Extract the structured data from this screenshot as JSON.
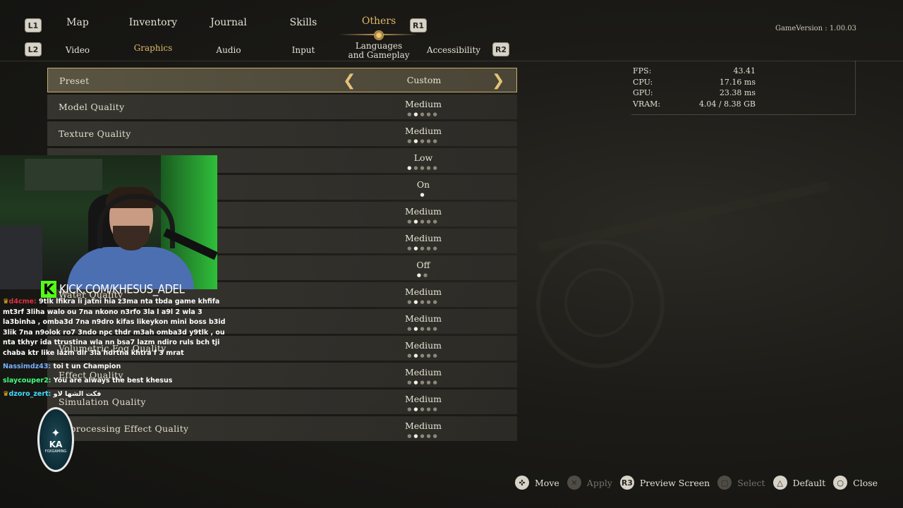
{
  "nav": {
    "left_main_badge": "L1",
    "right_main_badge": "R1",
    "left_sub_badge": "L2",
    "right_sub_badge": "R2",
    "main_tabs": [
      "Map",
      "Inventory",
      "Journal",
      "Skills",
      "Others"
    ],
    "sub_tabs": [
      "Video",
      "Graphics",
      "Audio",
      "Input",
      "Languages and Gameplay",
      "Accessibility"
    ],
    "active_main": "Others",
    "active_sub": "Graphics"
  },
  "game_version": "GameVersion : 1.00.03",
  "settings": [
    {
      "label": "Preset",
      "value": "Custom",
      "selected": true
    },
    {
      "label": "Model Quality",
      "value": "Medium",
      "level": 2,
      "levels": 5
    },
    {
      "label": "Texture Quality",
      "value": "Medium",
      "level": 2,
      "levels": 5
    },
    {
      "label": "",
      "value": "Low",
      "level": 1,
      "levels": 5
    },
    {
      "label": "",
      "value": "On",
      "level": 1,
      "levels": 1
    },
    {
      "label": "",
      "value": "Medium",
      "level": 2,
      "levels": 5
    },
    {
      "label": "",
      "value": "Medium",
      "level": 2,
      "levels": 5
    },
    {
      "label": "",
      "value": "Off",
      "level": 1,
      "levels": 2
    },
    {
      "label": "Water Quality",
      "value": "Medium",
      "level": 2,
      "levels": 5
    },
    {
      "label": "",
      "value": "Medium",
      "level": 2,
      "levels": 5
    },
    {
      "label": "Volumetric Fog Quality",
      "value": "Medium",
      "level": 2,
      "levels": 5
    },
    {
      "label": "Effect Quality",
      "value": "Medium",
      "level": 2,
      "levels": 5
    },
    {
      "label": "Simulation Quality",
      "value": "Medium",
      "level": 2,
      "levels": 5
    },
    {
      "label": "st-processing Effect Quality",
      "value": "Medium",
      "level": 2,
      "levels": 5
    }
  ],
  "stats": [
    {
      "label": "FPS:",
      "value": "43.41"
    },
    {
      "label": "CPU:",
      "value": "17.16  ms"
    },
    {
      "label": "GPU:",
      "value": "23.38  ms"
    },
    {
      "label": "VRAM:",
      "value": "4.04  /  8.38  GB"
    }
  ],
  "stream": {
    "kick_letter": "K",
    "kick_url": "KICK.COM/KHESUS_ADEL",
    "chat": [
      {
        "user": "d4cme:",
        "text": "9tlk lfikra li jatni hia z3ma nta tbda game khfifa mt3rf 3liha walo ou 7na nkono n3rfo 3la l a9l 2 wla 3 la3binha , omba3d 7na n9dro kifas likeykon mini boss b3id 3lik 7na n9olok ro7 3ndo npc thdr m3ah omba3d y9tlk , ou nta tkhyr ida ttrustina wla nn bsa7 lazm ndiro ruls bch tji chaba ktr like lazm dir 3la hdrtna khtra f 3 mrat",
        "class": "u1",
        "crown": "♛"
      },
      {
        "user": "Nassimdz43:",
        "text": "toi t un Champion",
        "class": "u2",
        "crown": ""
      },
      {
        "user": "slaycouper2:",
        "text": "You are always the best khesus",
        "class": "u4",
        "crown": ""
      },
      {
        "user": "dzoro_zert:",
        "text": "فكت الشها لاو",
        "class": "u3",
        "crown": "♛"
      }
    ],
    "badge_text": "KA",
    "badge_small": "FOXGAMING"
  },
  "controls": [
    {
      "icon": "✜",
      "label": "Move",
      "enabled": true
    },
    {
      "icon": "✕",
      "label": "Apply",
      "enabled": false
    },
    {
      "icon": "R3",
      "label": "Preview  Screen",
      "enabled": true
    },
    {
      "icon": "▢",
      "label": "Select",
      "enabled": false
    },
    {
      "icon": "△",
      "label": "Default",
      "enabled": true
    },
    {
      "icon": "○",
      "label": "Close",
      "enabled": true
    }
  ]
}
